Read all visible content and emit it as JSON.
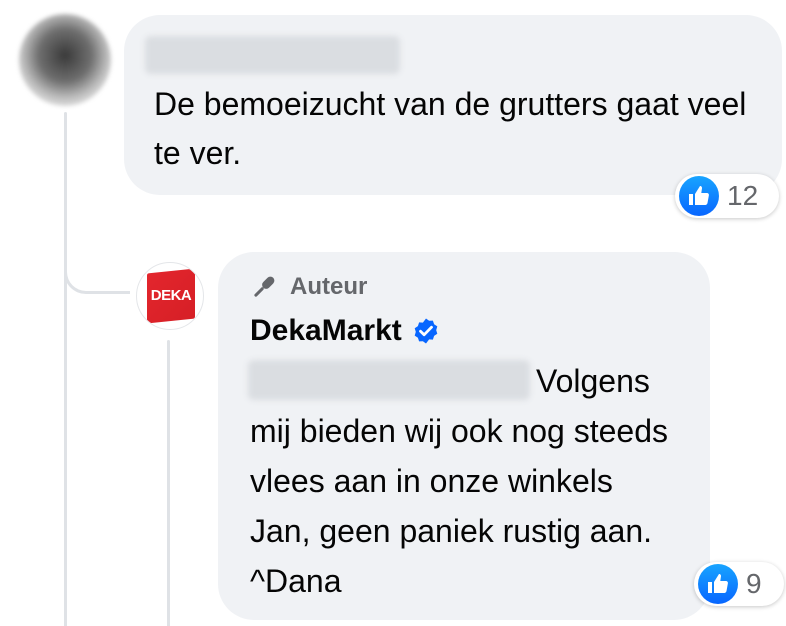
{
  "comment": {
    "text": "De bemoeizucht van de grutters gaat veel te ver.",
    "reaction_icon": "like-icon",
    "reaction_count": "12"
  },
  "reply": {
    "author_badge_label": "Auteur",
    "author_badge_icon": "microphone-icon",
    "page_name": "DekaMarkt",
    "verified_icon": "verified-badge-icon",
    "avatar_logo_text": "DEKA",
    "text": "Volgens mij bieden wij ook nog steeds vlees aan in onze winkels Jan, geen paniek rustig aan. ^Dana",
    "reaction_icon": "like-icon",
    "reaction_count": "9"
  },
  "colors": {
    "bubble_bg": "#f0f2f5",
    "like_blue": "#0866ff",
    "verified_blue": "#0866ff",
    "secondary_text": "#65676b",
    "deka_red": "#e3262d"
  }
}
